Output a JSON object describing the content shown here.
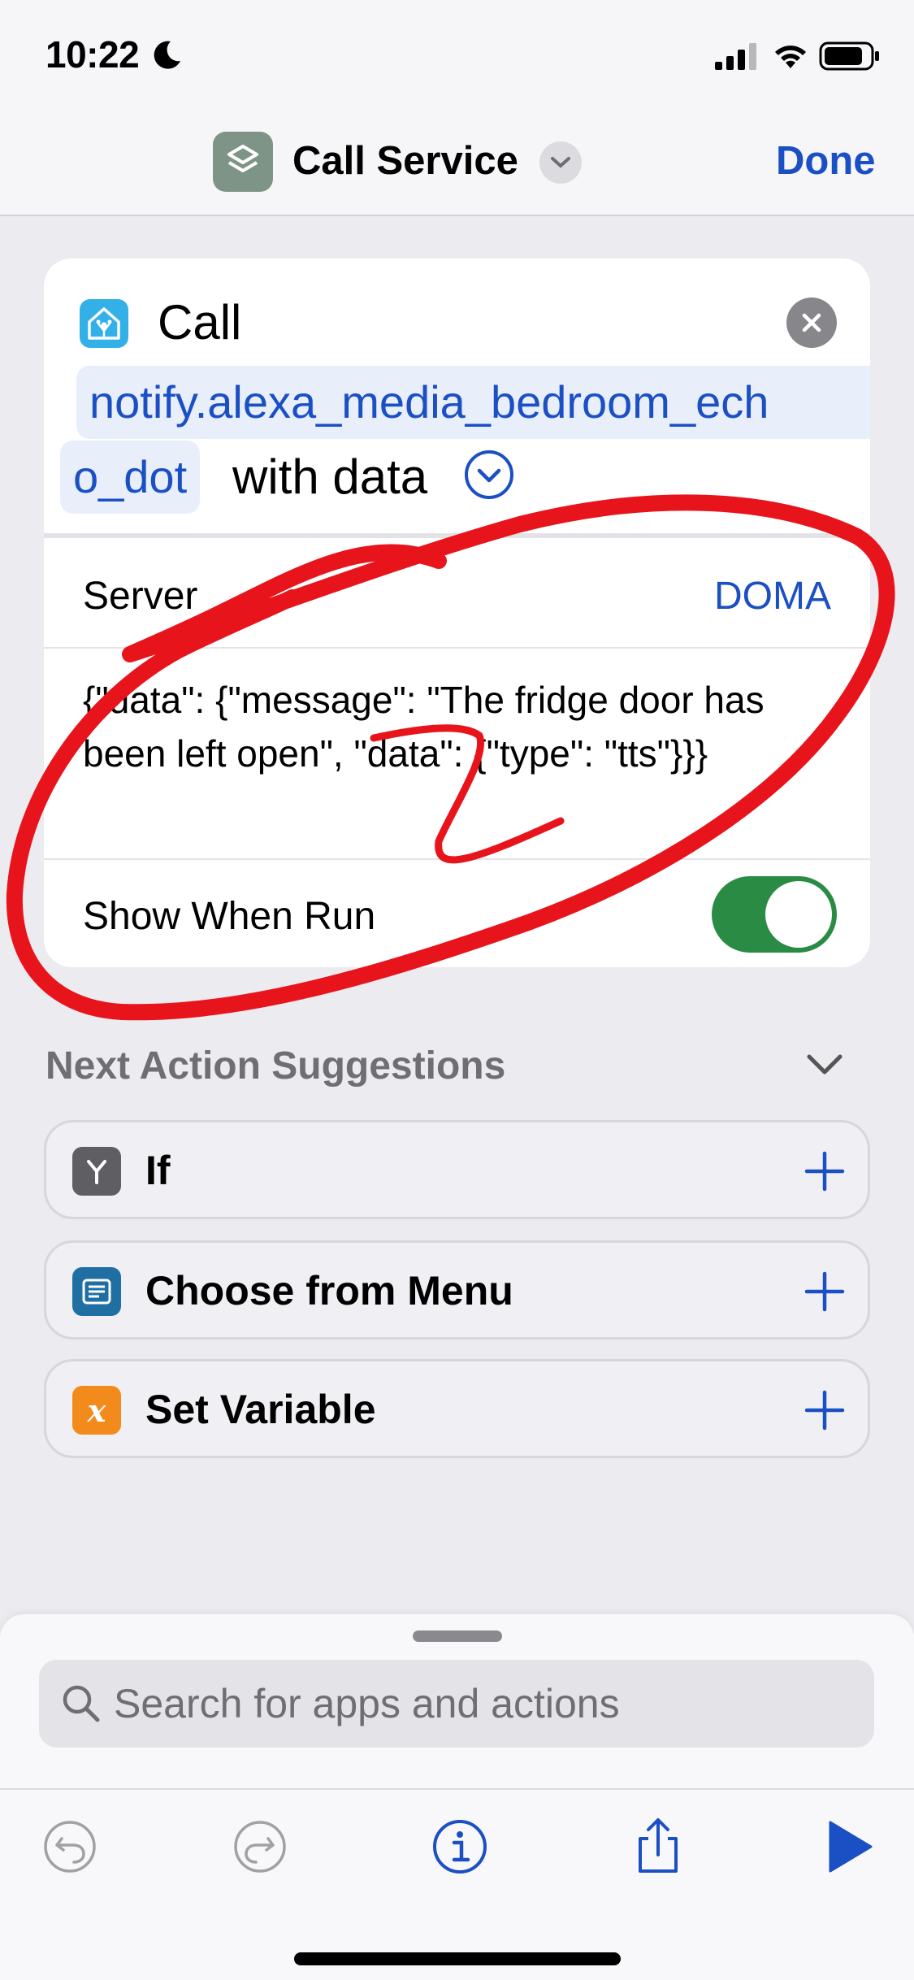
{
  "status_bar": {
    "time": "10:22",
    "icons": [
      "moon-icon",
      "cellular-signal-icon",
      "wifi-icon",
      "battery-icon"
    ]
  },
  "nav": {
    "title": "Call Service",
    "done_label": "Done",
    "app_icon": "shortcuts-icon"
  },
  "action": {
    "call_label": "Call",
    "service_line1": "notify.alexa_media_bedroom_ech",
    "service_line2": "o_dot",
    "with_data": "with data",
    "server_label": "Server",
    "server_value": "DOMA",
    "data_json": "{\"data\": {\"message\": \"The fridge door has been left open\", \"data\": {\"type\": \"tts\"}}}",
    "show_when_run_label": "Show When Run",
    "show_when_run": true
  },
  "suggestions": {
    "header": "Next Action Suggestions",
    "items": [
      {
        "label": "If",
        "icon": "branch-icon",
        "color": "#5e5e63"
      },
      {
        "label": "Choose from Menu",
        "icon": "menu-icon",
        "color": "#1f6fa3"
      },
      {
        "label": "Set Variable",
        "icon": "variable-icon",
        "glyph": "x",
        "color": "#f38b1c"
      }
    ]
  },
  "search": {
    "placeholder": "Search for apps and actions"
  },
  "toolbar": {
    "icons": [
      "undo-icon",
      "redo-icon",
      "info-icon",
      "share-icon",
      "play-icon"
    ]
  },
  "colors": {
    "accent": "#1b4fc4",
    "toggle_on": "#2a8b45",
    "annotation": "#e8141c"
  }
}
